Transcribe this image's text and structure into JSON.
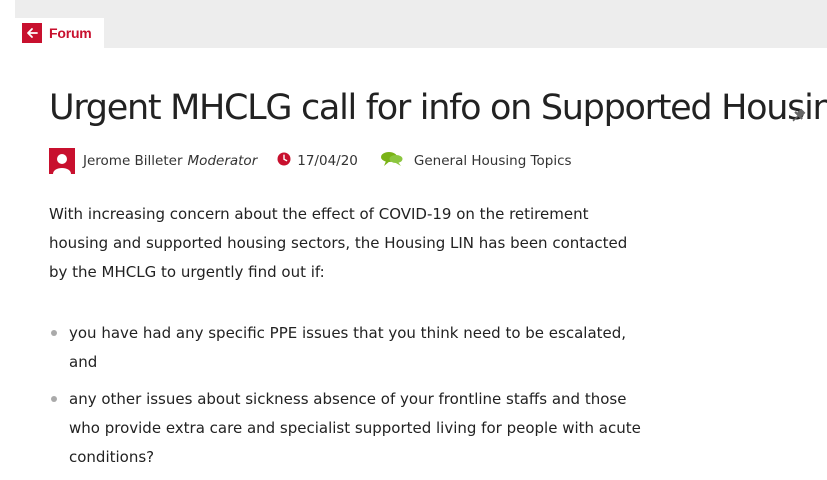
{
  "nav": {
    "back_tab_label": "Forum",
    "back_icon": "arrow-left-icon"
  },
  "post": {
    "title": "Urgent MHCLG call for info on Supported Housing",
    "pinned_icon": "pin-icon",
    "author": "Jerome Billeter",
    "author_role": "Moderator",
    "date": "17/04/20",
    "category": "General Housing Topics",
    "intro": "With increasing concern about the effect of COVID-19 on the retirement housing and supported housing sectors, the Housing LIN has been contacted by the MHCLG to urgently find out if:",
    "bullets": [
      "you have had any specific PPE issues that you think need to be escalated, and",
      "any other issues about sickness absence of your frontline staffs and those who provide extra care and specialist supported living for people with acute conditions?"
    ]
  },
  "colors": {
    "accent": "#c8102e",
    "topic_green": "#7ab317",
    "header_bg": "#ededed"
  }
}
